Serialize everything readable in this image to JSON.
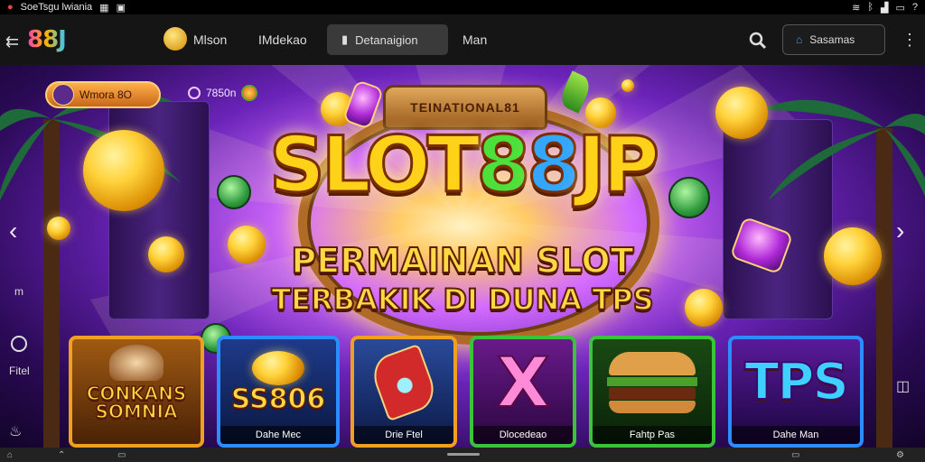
{
  "statusbar": {
    "left_text": "SoeTsgu lwiania",
    "icons": [
      "grid-icon",
      "map-icon"
    ],
    "right_icons": [
      "wifi-icon",
      "bluetooth-icon",
      "signal-icon",
      "battery-icon"
    ],
    "right_text": "?"
  },
  "navbar": {
    "logo_text": "88J",
    "links": [
      "Mlson",
      "IMdekao"
    ],
    "active_tab": "Detanaigion",
    "extra_link": "Man",
    "signin_label": "Sasamas",
    "menu_glyph": "⋮"
  },
  "hero": {
    "bonus_label": "Wmora 8O",
    "timer_text": "7850n",
    "banner_text": "TEINATIONAL81",
    "title_main": "SLOT",
    "title_green": "8",
    "title_blue": "8",
    "title_end": "JP",
    "subtitle_line1": "PERMAINAN SLOT",
    "subtitle_line2": "TERBAKIK DI DUNA TPS",
    "left_side_icons": [
      "m-icon",
      "clock-icon",
      "fire-icon",
      "photo-icon"
    ],
    "left_side_texts": [
      "m",
      "Fitel"
    ],
    "nav_arrows": {
      "prev": "‹",
      "next": "›"
    }
  },
  "cards": [
    {
      "title": "CONKANS\nSOMNIA",
      "label": "",
      "border": "#f0a020"
    },
    {
      "title": "SS806",
      "label": "Dahe Mec",
      "border": "#2d8cff"
    },
    {
      "title": "",
      "label": "Drie Ftel",
      "border": "#f0a020"
    },
    {
      "title": "X",
      "label": "Dlocedeao",
      "border": "#3bc43b"
    },
    {
      "title": "",
      "label": "Fahtp Pas",
      "border": "#3bc43b"
    },
    {
      "title": "TPS",
      "label": "Dahe Man",
      "border": "#2d8cff"
    }
  ],
  "colors": {
    "accent_gold": "#ffd21a",
    "accent_purple": "#6a23b8",
    "navbar_bg": "#151515"
  }
}
